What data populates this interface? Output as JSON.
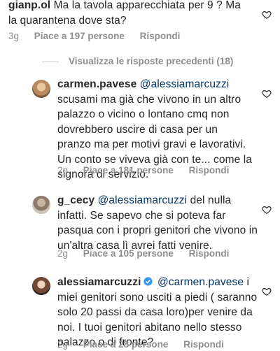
{
  "comments": [
    {
      "user": "gianp.ol",
      "text": "Ma la tavola apparecchiata per 9 ? Ma la quarantena dove sta?",
      "age": "3g",
      "likes": "Piace a 197 persone",
      "reply": "Rispondi"
    },
    {
      "user": "carmen.pavese",
      "mention": "@alessiamarcuzzi",
      "text": "scusami ma già che vivono in un altro palazzo o vicino o lontano cmq non dovrebbero uscire di casa per un pranzo ma per motivi gravi e lavorativi. Un conto se viveva già con te... come la signora di servizio.",
      "age": "2g",
      "likes": "Piace a 181 persone",
      "reply": "Rispondi"
    },
    {
      "user": "g_cecy",
      "mention": "@alessiamarcuzzi",
      "text": "del nulla infatti. Se sapevo che si poteva far pasqua con i propri genitori che vivono in un'altra casa lì avrei fatti venire.",
      "age": "2g",
      "likes": "Piace a 105 persone",
      "reply": "Rispondi"
    },
    {
      "user": "alessiamarcuzzi",
      "verified": true,
      "mention": "@carmen.pavese",
      "text": "i miei genitori sono usciti a piedi ( saranno solo 20 passi da casa loro)per venire da noi. I tuoi genitori abitano nello stesso palazzo o di fronte?",
      "age": "2g",
      "likes": "Piace a 28 persone",
      "reply": "Rispondi"
    }
  ],
  "view_previous": "Visualizza le risposte precedenti (18)",
  "colors": {
    "text": "#262626",
    "meta": "#8e8e8e",
    "mention": "#003569",
    "verified": "#3897f0"
  }
}
